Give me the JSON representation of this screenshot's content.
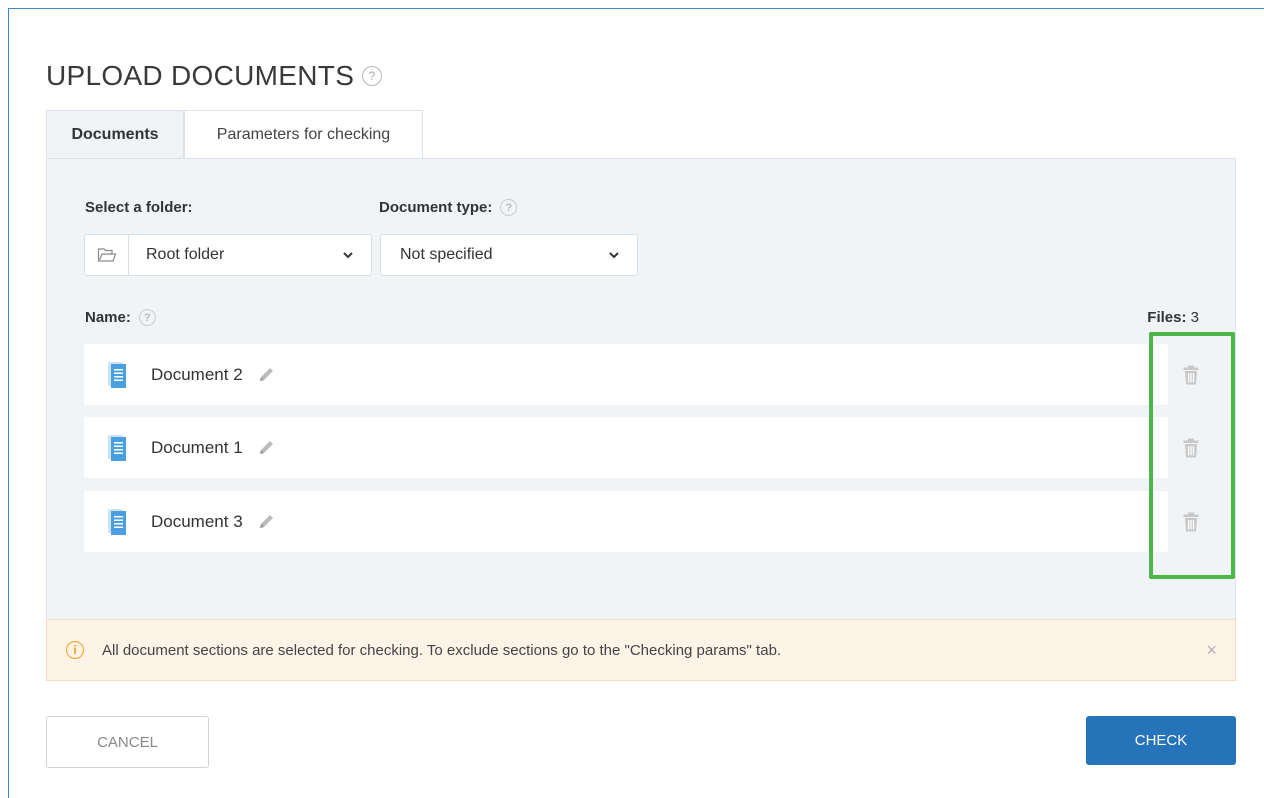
{
  "page": {
    "title": "UPLOAD DOCUMENTS"
  },
  "tabs": [
    {
      "label": "Documents",
      "active": true
    },
    {
      "label": "Parameters for checking",
      "active": false
    }
  ],
  "folder": {
    "label": "Select a folder:",
    "value": "Root folder"
  },
  "doc_type": {
    "label": "Document type:",
    "value": "Not specified"
  },
  "name_label": "Name:",
  "files": {
    "label": "Files:",
    "count": "3"
  },
  "documents": [
    {
      "name": "Document 2"
    },
    {
      "name": "Document 1"
    },
    {
      "name": "Document 3"
    }
  ],
  "notice": {
    "icon": "info-icon",
    "text": "All document sections are selected for checking. To exclude sections go to the \"Checking params\" tab.",
    "close": "×"
  },
  "buttons": {
    "cancel": "CANCEL",
    "check": "CHECK"
  },
  "colors": {
    "accent": "#2573b8",
    "highlight": "#4cb648",
    "notice_bg": "#fdf3e6",
    "panel_bg": "#f1f4f7"
  }
}
